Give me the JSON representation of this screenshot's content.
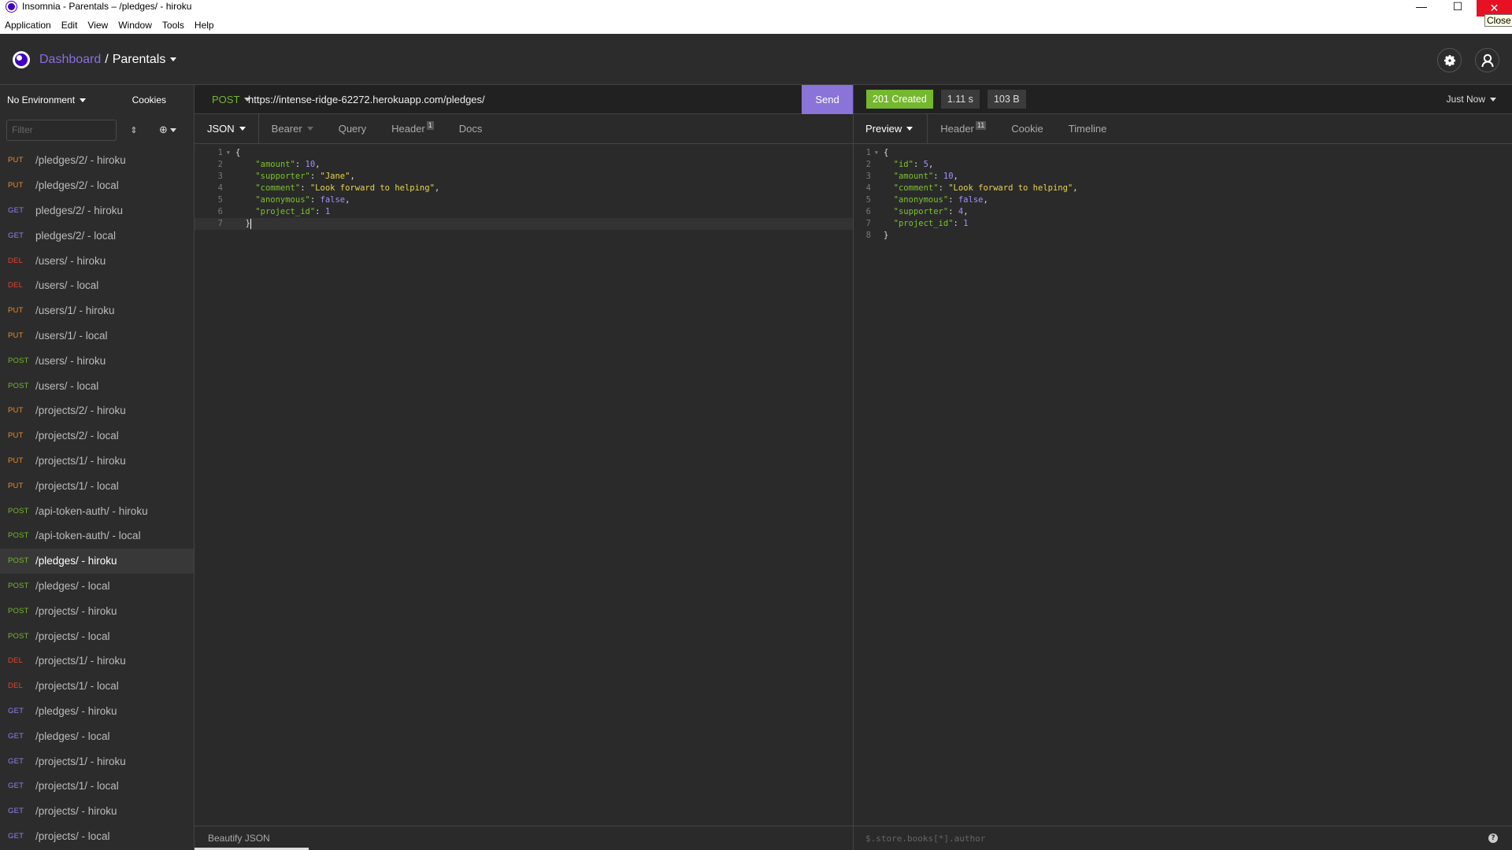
{
  "window": {
    "title": "Insomnia - Parentals – /pledges/ - hiroku",
    "menu": [
      "Application",
      "Edit",
      "View",
      "Window",
      "Tools",
      "Help"
    ],
    "controls": {
      "minimize": "—",
      "maximize": "☐",
      "close": "✕"
    },
    "tooltip": "Close"
  },
  "header": {
    "dashboard": "Dashboard",
    "separator": "/",
    "workspace": "Parentals"
  },
  "sidebar": {
    "environment": "No Environment",
    "cookies": "Cookies",
    "filter_placeholder": "Filter",
    "requests": [
      {
        "method": "PUT",
        "name": "/pledges/2/ - hiroku"
      },
      {
        "method": "PUT",
        "name": "/pledges/2/ - local"
      },
      {
        "method": "GET",
        "name": "pledges/2/ - hiroku"
      },
      {
        "method": "GET",
        "name": "pledges/2/ - local"
      },
      {
        "method": "DEL",
        "name": "/users/ - hiroku"
      },
      {
        "method": "DEL",
        "name": "/users/ - local"
      },
      {
        "method": "PUT",
        "name": "/users/1/ - hiroku"
      },
      {
        "method": "PUT",
        "name": "/users/1/ - local"
      },
      {
        "method": "POST",
        "name": "/users/ - hiroku"
      },
      {
        "method": "POST",
        "name": "/users/ - local"
      },
      {
        "method": "PUT",
        "name": "/projects/2/ - hiroku"
      },
      {
        "method": "PUT",
        "name": "/projects/2/ - local"
      },
      {
        "method": "PUT",
        "name": "/projects/1/ - hiroku"
      },
      {
        "method": "PUT",
        "name": "/projects/1/ - local"
      },
      {
        "method": "POST",
        "name": "/api-token-auth/ - hiroku"
      },
      {
        "method": "POST",
        "name": "/api-token-auth/ - local"
      },
      {
        "method": "POST",
        "name": "/pledges/ - hiroku",
        "active": true
      },
      {
        "method": "POST",
        "name": "/pledges/ - local"
      },
      {
        "method": "POST",
        "name": "/projects/ - hiroku"
      },
      {
        "method": "POST",
        "name": "/projects/ - local"
      },
      {
        "method": "DEL",
        "name": "/projects/1/ - hiroku"
      },
      {
        "method": "DEL",
        "name": "/projects/1/ - local"
      },
      {
        "method": "GET",
        "name": "/pledges/ - hiroku"
      },
      {
        "method": "GET",
        "name": "/pledges/ - local"
      },
      {
        "method": "GET",
        "name": "/projects/1/ - hiroku"
      },
      {
        "method": "GET",
        "name": "/projects/1/ - local"
      },
      {
        "method": "GET",
        "name": "/projects/ - hiroku"
      },
      {
        "method": "GET",
        "name": "/projects/ - local"
      }
    ]
  },
  "request": {
    "method": "POST",
    "url": "https://intense-ridge-62272.herokuapp.com/pledges/",
    "send_label": "Send",
    "tabs": [
      {
        "label": "JSON",
        "active": true,
        "dropdown": true
      },
      {
        "label": "Bearer",
        "dropdown": true
      },
      {
        "label": "Query"
      },
      {
        "label": "Header",
        "badge": "1"
      },
      {
        "label": "Docs"
      }
    ],
    "body_lines": [
      [
        {
          "t": "p",
          "v": "{"
        }
      ],
      [
        {
          "t": "p",
          "v": "    "
        },
        {
          "t": "k",
          "v": "\"amount\""
        },
        {
          "t": "p",
          "v": ": "
        },
        {
          "t": "n",
          "v": "10"
        },
        {
          "t": "p",
          "v": ","
        }
      ],
      [
        {
          "t": "p",
          "v": "    "
        },
        {
          "t": "k",
          "v": "\"supporter\""
        },
        {
          "t": "p",
          "v": ": "
        },
        {
          "t": "s",
          "v": "\"Jane\""
        },
        {
          "t": "p",
          "v": ","
        }
      ],
      [
        {
          "t": "p",
          "v": "    "
        },
        {
          "t": "k",
          "v": "\"comment\""
        },
        {
          "t": "p",
          "v": ": "
        },
        {
          "t": "s",
          "v": "\"Look forward to helping\""
        },
        {
          "t": "p",
          "v": ","
        }
      ],
      [
        {
          "t": "p",
          "v": "    "
        },
        {
          "t": "k",
          "v": "\"anonymous\""
        },
        {
          "t": "p",
          "v": ": "
        },
        {
          "t": "n",
          "v": "false"
        },
        {
          "t": "p",
          "v": ","
        }
      ],
      [
        {
          "t": "p",
          "v": "    "
        },
        {
          "t": "k",
          "v": "\"project_id\""
        },
        {
          "t": "p",
          "v": ": "
        },
        {
          "t": "n",
          "v": "1"
        }
      ],
      [
        {
          "t": "p",
          "v": "  }"
        }
      ]
    ],
    "beautify_label": "Beautify JSON"
  },
  "response": {
    "status": "201 Created",
    "status_color": "#75b72e",
    "time": "1.11 s",
    "size": "103 B",
    "history": "Just Now",
    "tabs": [
      {
        "label": "Preview",
        "active": true,
        "dropdown": true
      },
      {
        "label": "Header",
        "badge": "11"
      },
      {
        "label": "Cookie"
      },
      {
        "label": "Timeline"
      }
    ],
    "body_lines": [
      [
        {
          "t": "p",
          "v": "{"
        }
      ],
      [
        {
          "t": "p",
          "v": "  "
        },
        {
          "t": "k",
          "v": "\"id\""
        },
        {
          "t": "p",
          "v": ": "
        },
        {
          "t": "n",
          "v": "5"
        },
        {
          "t": "p",
          "v": ","
        }
      ],
      [
        {
          "t": "p",
          "v": "  "
        },
        {
          "t": "k",
          "v": "\"amount\""
        },
        {
          "t": "p",
          "v": ": "
        },
        {
          "t": "n",
          "v": "10"
        },
        {
          "t": "p",
          "v": ","
        }
      ],
      [
        {
          "t": "p",
          "v": "  "
        },
        {
          "t": "k",
          "v": "\"comment\""
        },
        {
          "t": "p",
          "v": ": "
        },
        {
          "t": "s",
          "v": "\"Look forward to helping\""
        },
        {
          "t": "p",
          "v": ","
        }
      ],
      [
        {
          "t": "p",
          "v": "  "
        },
        {
          "t": "k",
          "v": "\"anonymous\""
        },
        {
          "t": "p",
          "v": ": "
        },
        {
          "t": "n",
          "v": "false"
        },
        {
          "t": "p",
          "v": ","
        }
      ],
      [
        {
          "t": "p",
          "v": "  "
        },
        {
          "t": "k",
          "v": "\"supporter\""
        },
        {
          "t": "p",
          "v": ": "
        },
        {
          "t": "n",
          "v": "4"
        },
        {
          "t": "p",
          "v": ","
        }
      ],
      [
        {
          "t": "p",
          "v": "  "
        },
        {
          "t": "k",
          "v": "\"project_id\""
        },
        {
          "t": "p",
          "v": ": "
        },
        {
          "t": "n",
          "v": "1"
        }
      ],
      [
        {
          "t": "p",
          "v": "}"
        }
      ]
    ],
    "filter_placeholder": "$.store.books[*].author",
    "help_icon": "?"
  },
  "icons": {
    "gear": "⚙",
    "user": "user-icon",
    "sort": "⇕",
    "add": "⊕"
  },
  "colors": {
    "accent": "#8a74d8",
    "put": "#ea8a2b",
    "get": "#8d84f0",
    "del": "#e9402d",
    "post": "#75b72e"
  }
}
